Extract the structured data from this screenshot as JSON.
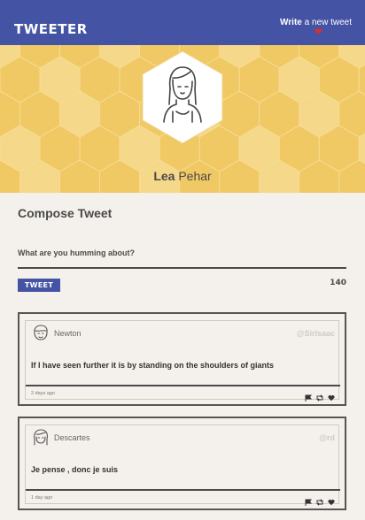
{
  "nav": {
    "logo": "TWEETER",
    "write_bold": "Write",
    "write_rest": " a new tweet",
    "colors": {
      "bar": "#4453a4",
      "heart": "#cc3333"
    },
    "icons": {
      "write": "heart-icon"
    }
  },
  "profile": {
    "first_name": "Lea",
    "last_name": "Pehar",
    "banner_color": "#f2cd6e"
  },
  "compose": {
    "title": "Compose Tweet",
    "placeholder": "What are you humming about?",
    "button_label": "TWEET",
    "char_count": "140"
  },
  "tweets": [
    {
      "name": "Newton",
      "handle": "@SirIsaac",
      "text": "If I have seen further it is by standing on the shoulders of giants",
      "time": "2 days ago",
      "avatar_icon": "man-avatar-icon"
    },
    {
      "name": "Descartes",
      "handle": "@rd",
      "text": "Je pense , donc je suis",
      "time": "1 day ago",
      "avatar_icon": "woman-avatar-icon"
    }
  ],
  "tweet_actions": [
    "flag-icon",
    "retweet-icon",
    "heart-icon"
  ]
}
